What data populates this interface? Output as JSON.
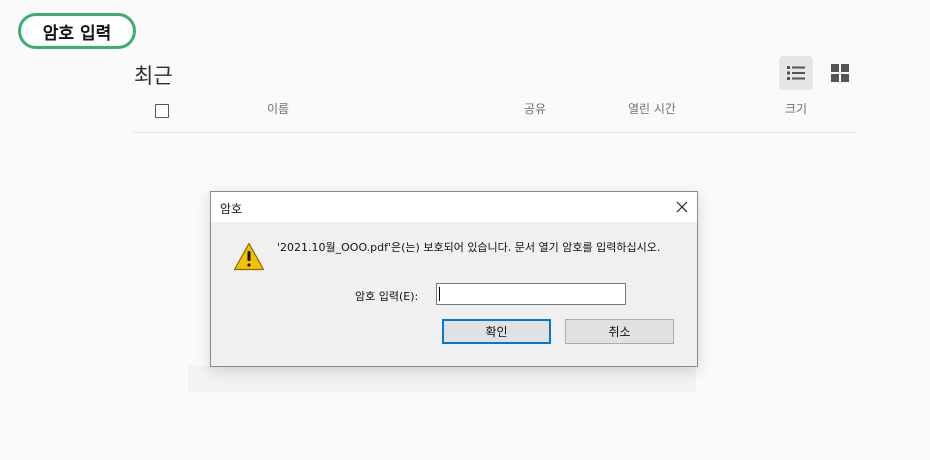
{
  "step_badge": "암호 입력",
  "recent": {
    "title": "최근",
    "view_list_icon": "list-view-icon",
    "view_grid_icon": "grid-view-icon",
    "columns": {
      "name": "이름",
      "share": "공유",
      "opened": "열린 시간",
      "size": "크기"
    }
  },
  "dialog": {
    "title": "암호",
    "close_icon": "close-icon",
    "warning_icon": "warning-icon",
    "message": "'2021.10월_OOO.pdf'은(는) 보호되어 있습니다. 문서 열기 암호를 입력하십시오.",
    "password_label": "암호 입력(E):",
    "password_value": "",
    "ok_label": "확인",
    "cancel_label": "취소"
  },
  "colors": {
    "badge_border": "#3aaf6e",
    "ok_focus": "#0078d7",
    "warning_fill": "#f2c200"
  }
}
